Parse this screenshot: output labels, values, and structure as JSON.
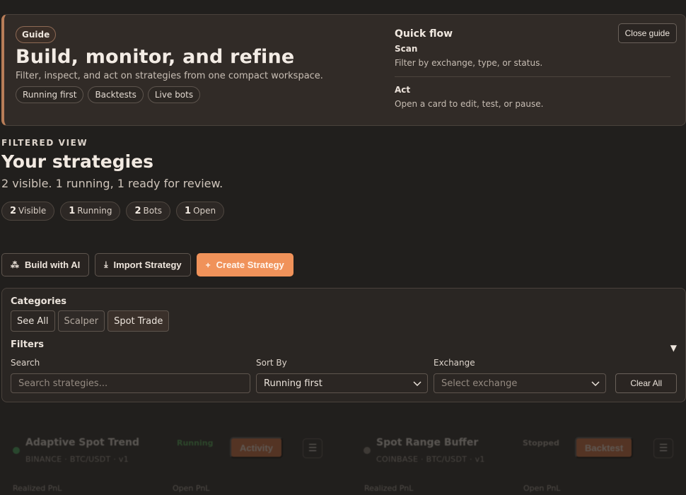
{
  "guide": {
    "badge": "Guide",
    "title": "Build, monitor, and refine",
    "subtitle": "Filter, inspect, and act on strategies from one compact workspace.",
    "chips": [
      "Running first",
      "Backtests",
      "Live bots"
    ],
    "quick_flow": {
      "title": "Quick flow",
      "steps": [
        {
          "title": "Scan",
          "desc": "Filter by exchange, type, or status."
        },
        {
          "title": "Act",
          "desc": "Open a card to edit, test, or pause."
        }
      ]
    },
    "close_label": "Close guide"
  },
  "header": {
    "eyebrow": "FILTERED VIEW",
    "title": "Your strategies",
    "subtitle": "2 visible. 1 running, 1 ready for review."
  },
  "stats": [
    {
      "num": "2",
      "label": "Visible"
    },
    {
      "num": "1",
      "label": "Running"
    },
    {
      "num": "2",
      "label": "Bots"
    },
    {
      "num": "1",
      "label": "Open"
    }
  ],
  "actions": {
    "build_ai": "Build with AI",
    "import": "Import Strategy",
    "create": "Create Strategy"
  },
  "filters": {
    "categories_heading": "Categories",
    "categories": [
      "See All",
      "Scalper",
      "Spot Trade"
    ],
    "filters_heading": "Filters",
    "toggle_icon": "▼",
    "search_label": "Search",
    "search_placeholder": "Search strategies...",
    "sort_label": "Sort By",
    "sort_value": "Running first",
    "exchange_label": "Exchange",
    "exchange_placeholder": "Select exchange",
    "clear_all": "Clear All"
  },
  "strategies": [
    {
      "name": "Adaptive Spot Trend",
      "meta": "BINANCE · BTC/USDT · v1",
      "status": "Running",
      "status_color": "#4caf50",
      "action": "Activity",
      "realized_label": "Realized PnL",
      "open_label": "Open PnL"
    },
    {
      "name": "Spot Range Buffer",
      "meta": "COINBASE · BTC/USDT · v1",
      "status": "Stopped",
      "status_color": "#9a9088",
      "action": "Backtest",
      "realized_label": "Realized PnL",
      "open_label": "Open PnL"
    }
  ],
  "colors": {
    "background": "#211f1d",
    "accent": "#f0925a",
    "card": "#312b27"
  }
}
